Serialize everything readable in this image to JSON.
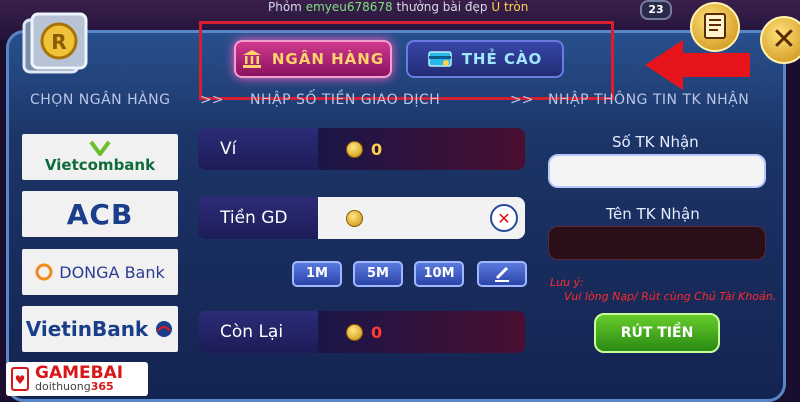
{
  "ticker": {
    "prefix": "Phỏm",
    "user": "emyeu678678",
    "middle": "thưởng bài đẹp",
    "win": "Ù tròn"
  },
  "badge": "23",
  "tabs": [
    {
      "label": "NGÂN HÀNG",
      "active": true
    },
    {
      "label": "THẺ CÀO",
      "active": false
    }
  ],
  "headers": {
    "choose_bank": "CHỌN NGÂN HÀNG",
    "amount": "NHẬP SỐ TIỀN GIAO DỊCH",
    "recipient": "NHẬP THÔNG TIN TK NHẬN",
    "sep": ">>"
  },
  "banks": [
    "Vietcombank",
    "ACB",
    "DONGA Bank",
    "VietinBank"
  ],
  "fields": {
    "wallet": {
      "label": "Ví",
      "value": "0"
    },
    "amount": {
      "label": "Tiền GD",
      "value": ""
    },
    "remaining": {
      "label": "Còn Lại",
      "value": "0"
    }
  },
  "quick_amounts": [
    "1M",
    "5M",
    "10M"
  ],
  "recipient": {
    "account_label": "Số TK Nhận",
    "name_label": "Tên TK Nhận",
    "note_title": "Lưu ý:",
    "note_text": "Vui lòng Nạp/ Rút cùng Chủ Tài Khoản."
  },
  "withdraw_button": "RÚT TIỀN",
  "watermark": {
    "main": "GAMEBAI",
    "sub": "doithuong",
    "sub_num": "365"
  },
  "colors": {
    "active_tab": "#c4307f",
    "inactive_tab": "#2c3890",
    "highlight_frame": "#d62030",
    "warning": "#ff2a2a",
    "confirm": "#4aa81e"
  }
}
